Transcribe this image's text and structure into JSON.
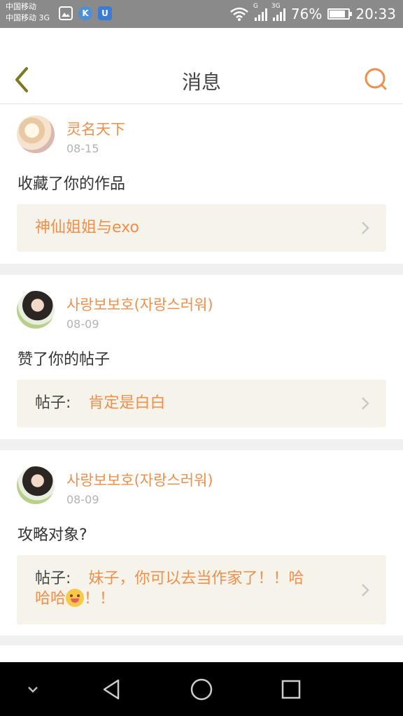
{
  "status_bar": {
    "carrier_1": "中国移动",
    "carrier_2": "中国移动 3G",
    "network_1": "G",
    "network_2": "3G",
    "battery_percent": "76%",
    "battery_level": 0.76,
    "time": "20:33"
  },
  "header": {
    "title": "消息"
  },
  "messages": [
    {
      "username": "灵名天下",
      "date": "08-15",
      "text": "收藏了你的作品",
      "ref_prefix": "",
      "ref_text": "神仙姐姐与exo"
    },
    {
      "username": "사랑보보호(자랑스러워)",
      "date": "08-09",
      "text": "赞了你的帖子",
      "ref_prefix": "帖子:",
      "ref_text": "肯定是白白"
    },
    {
      "username": "사랑보보호(자랑스러워)",
      "date": "08-09",
      "text": "攻略对象?",
      "ref_prefix": "帖子:",
      "ref_text_1": "妹子，你可以去当作家了！！哈",
      "ref_text_2": "哈哈",
      "ref_text_3": "！！"
    }
  ],
  "colors": {
    "accent": "#ef8f4c",
    "status_bar": "#8a8a8a",
    "ref_background": "#f5f3ea",
    "separator": "#f0f0f0"
  },
  "icons": {
    "back": "chevron-left-icon",
    "search": "search-icon",
    "nav_down": "chevron-down-icon",
    "nav_back": "triangle-back-icon",
    "nav_home": "circle-home-icon",
    "nav_recent": "square-recent-icon"
  }
}
